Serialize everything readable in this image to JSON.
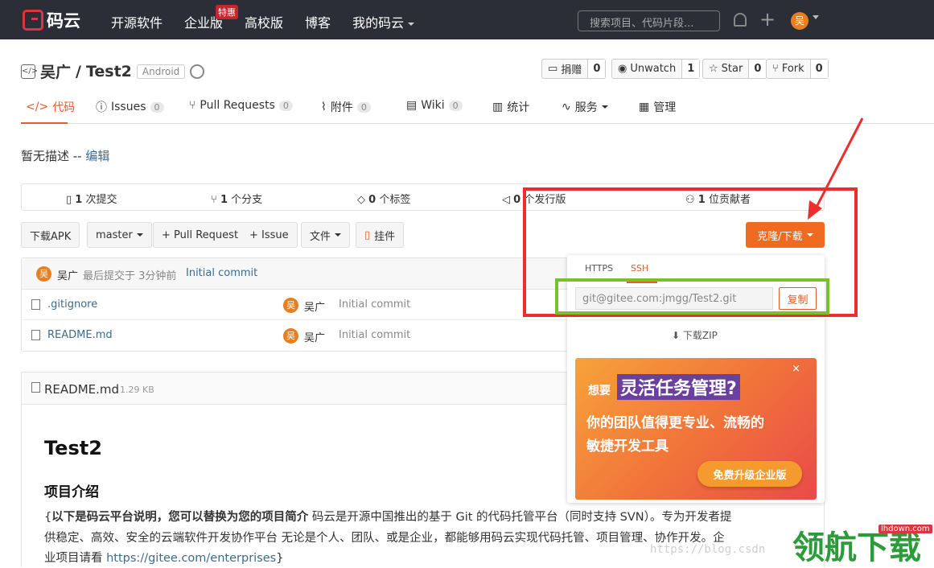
{
  "topnav": {
    "logo_text": "码云",
    "links": [
      "开源软件",
      "企业版",
      "高校版",
      "博客",
      "我的码云"
    ],
    "hot_badge": "特惠",
    "search_placeholder": "搜索项目、代码片段...",
    "avatar_letter": "吴"
  },
  "repo": {
    "owner": "吴广",
    "separator": "/",
    "name": "Test2",
    "tag": "Android",
    "actions": [
      {
        "label": "捐赠",
        "count": "0"
      },
      {
        "label": "Unwatch",
        "count": "1"
      },
      {
        "label": "Star",
        "count": "0"
      },
      {
        "label": "Fork",
        "count": "0"
      }
    ]
  },
  "tabs": [
    {
      "label": "代码",
      "count": ""
    },
    {
      "label": "Issues",
      "count": "0"
    },
    {
      "label": "Pull Requests",
      "count": "0"
    },
    {
      "label": "附件",
      "count": "0"
    },
    {
      "label": "Wiki",
      "count": "0"
    },
    {
      "label": "统计",
      "count": ""
    },
    {
      "label": "服务",
      "count": ""
    },
    {
      "label": "管理",
      "count": ""
    }
  ],
  "description": {
    "text": "暂无描述 -- ",
    "edit_link": "编辑"
  },
  "stats": [
    {
      "num": "1",
      "label": "次提交"
    },
    {
      "num": "1",
      "label": "个分支"
    },
    {
      "num": "0",
      "label": "个标签"
    },
    {
      "num": "0",
      "label": "个发行版"
    },
    {
      "num": "1",
      "label": "位贡献者"
    }
  ],
  "toolbar": {
    "download_apk": "下载APK",
    "branch": "master",
    "pull_request": "+ Pull Request",
    "issue": "+ Issue",
    "files": "文件",
    "widget": "挂件",
    "clone": "克隆/下载"
  },
  "commit_bar": {
    "author": "吴广",
    "text": "最后提交于 3分钟前",
    "message": "Initial commit"
  },
  "files": [
    {
      "name": ".gitignore",
      "author": "吴广",
      "message": "Initial commit"
    },
    {
      "name": "README.md",
      "author": "吴广",
      "message": "Initial commit"
    }
  ],
  "readme": {
    "filename": "README.md",
    "size": "1.29 KB",
    "h1": "Test2",
    "h2": "项目介绍",
    "p1_bold": "以下是码云平台说明，您可以替换为您的项目简介",
    "p1_rest": " 码云是开源中国推出的基于 Git 的代码托管平台（同时支持 SVN）。专为开发者提",
    "p2": "供稳定、高效、安全的云端软件开发协作平台 无论是个人、团队、或是企业，都能够用码云实现代码托管、项目管理、协作开发。企",
    "p3_prefix": "业项目请看 ",
    "p3_link": "https://gitee.com/enterprises",
    "p3_suffix": "}",
    "p1_brace": "{"
  },
  "clone_dropdown": {
    "tab_https": "HTTPS",
    "tab_ssh": "SSH",
    "url": "git@gitee.com:jmgg/Test2.git",
    "copy": "复制",
    "download_zip": "下载ZIP",
    "promo": {
      "small": "想要",
      "big": "灵活任务管理?",
      "line1": "你的团队值得更专业、流畅的",
      "line2": "敏捷开发工具",
      "button": "免费升级企业版"
    }
  },
  "watermark": {
    "url": "https://blog.csdn",
    "logo": "领航下载",
    "tag": "lhdown.com"
  },
  "colors": {
    "accent": "#e15e2c",
    "nav_bg": "#2b2d37",
    "annotation_red": "#ee2e2e",
    "annotation_green": "#7bc02c"
  }
}
